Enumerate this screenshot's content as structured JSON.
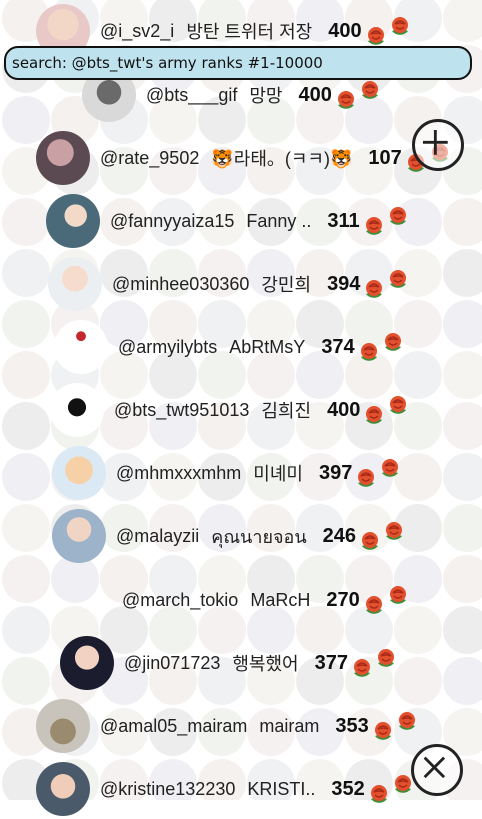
{
  "search": {
    "text": "search: @bts_twt's army ranks #1-10000"
  },
  "actions": {
    "add_icon": "plus-icon",
    "close_icon": "close-icon"
  },
  "colors": {
    "search_bg": "#bfe3ee",
    "rose": "#e2502e",
    "leaf": "#3e8e3a"
  },
  "rows": [
    {
      "handle": "@i_sv2_i",
      "name": "방탄 트위터 저장",
      "count": "400"
    },
    {
      "handle": "@bts___gif",
      "name": "망망",
      "count": "400"
    },
    {
      "handle": "@rate_9502",
      "name": "🐯라태。(ㅋㅋ)🐯",
      "count": "107"
    },
    {
      "handle": "@fannyyaiza15",
      "name": "Fanny ..",
      "count": "311"
    },
    {
      "handle": "@minhee030360",
      "name": "강민희",
      "count": "394"
    },
    {
      "handle": "@armyilybts",
      "name": "AbRtMsY",
      "count": "374"
    },
    {
      "handle": "@bts_twt951013",
      "name": "김희진",
      "count": "400"
    },
    {
      "handle": "@mhmxxxmhm",
      "name": "미녜미",
      "count": "397"
    },
    {
      "handle": "@malayzii",
      "name": "คุณนายจอน",
      "count": "246"
    },
    {
      "handle": "@march_tokio",
      "name": "MaRcH",
      "count": "270"
    },
    {
      "handle": "@jin071723",
      "name": "행복했어",
      "count": "377"
    },
    {
      "handle": "@amal05_mairam",
      "name": "mairam",
      "count": "353"
    },
    {
      "handle": "@kristine132230",
      "name": "KRISTI..",
      "count": "352"
    }
  ]
}
